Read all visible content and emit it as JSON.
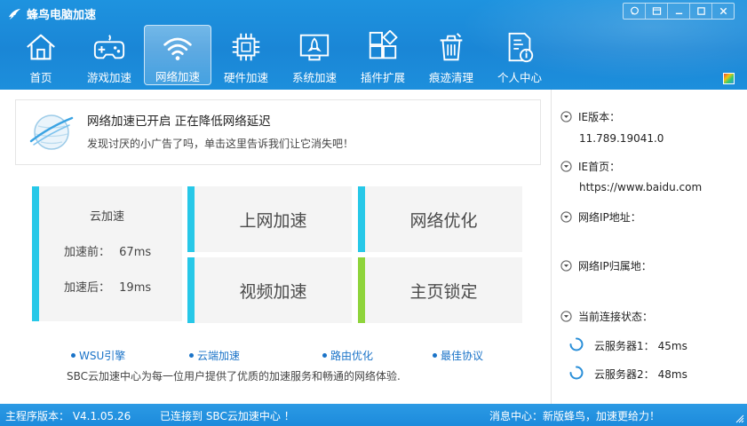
{
  "app": {
    "title": "蜂鸟电脑加速"
  },
  "window_controls": {
    "feedback": "◎",
    "menu": "▭",
    "minimize": "−",
    "maximize": "□",
    "close": "×"
  },
  "nav": [
    {
      "label": "首页",
      "icon": "home-icon"
    },
    {
      "label": "游戏加速",
      "icon": "gamepad-icon"
    },
    {
      "label": "网络加速",
      "icon": "wifi-icon",
      "active": true
    },
    {
      "label": "硬件加速",
      "icon": "chip-icon"
    },
    {
      "label": "系统加速",
      "icon": "rocket-icon"
    },
    {
      "label": "插件扩展",
      "icon": "plugin-icon"
    },
    {
      "label": "痕迹清理",
      "icon": "trash-icon"
    },
    {
      "label": "个人中心",
      "icon": "document-icon"
    }
  ],
  "notice": {
    "title": "网络加速已开启  正在降低网络延迟",
    "subtitle": "发现讨厌的小广告了吗，单击这里告诉我们让它消失吧！"
  },
  "cloud": {
    "title": "云加速",
    "before_label": "加速前：",
    "before_value": "67ms",
    "after_label": "加速后：",
    "after_value": "19ms"
  },
  "tiles": {
    "internet": "上网加速",
    "network": "网络优化",
    "video": "视频加速",
    "homepage": "主页锁定"
  },
  "colors": {
    "accent": "#27c8e8",
    "lock_accent": "#8ed43b",
    "link": "#1a73c8",
    "header": "#1a86d6"
  },
  "features": [
    "WSU引擎",
    "云端加速",
    "路由优化",
    "最佳协议"
  ],
  "description": "SBC云加速中心为每一位用户提供了优质的加速服务和畅通的网络体验.",
  "side": {
    "ie_version_label": "IE版本：",
    "ie_version_value": "11.789.19041.0",
    "ie_home_label": "IE首页：",
    "ie_home_value": "https://www.baidu.com",
    "ip_label": "网络IP地址：",
    "ip_location_label": "网络IP归属地：",
    "connection_label": "当前连接状态：",
    "server1_label": "云服务器1：",
    "server1_value": "45ms",
    "server2_label": "云服务器2：",
    "server2_value": "48ms"
  },
  "status_bar": {
    "version": "主程序版本： V4.1.05.26",
    "connection": "已连接到 SBC云加速中心 ！",
    "message": "消息中心：新版蜂鸟，加速更给力！"
  }
}
